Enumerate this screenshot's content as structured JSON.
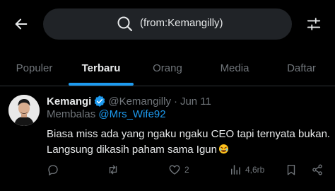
{
  "search": {
    "query": "(from:Kemangilly)"
  },
  "tabs": [
    {
      "label": "Populer"
    },
    {
      "label": "Terbaru"
    },
    {
      "label": "Orang"
    },
    {
      "label": "Media"
    },
    {
      "label": "Daftar"
    }
  ],
  "active_tab": "Terbaru",
  "tweet": {
    "display_name": "Kemangi",
    "handle": "@Kemangilly",
    "separator": "·",
    "date": "Jun 11",
    "reply_prefix": "Membalas",
    "reply_to": "@Mrs_Wife92",
    "text_line1": "Biasa miss ada yang ngaku ngaku CEO tapi ternyata bukan.",
    "text_line2": "Langsung dikasih paham sama Igun",
    "likes": "2",
    "views": "4,6rb"
  },
  "icons": {
    "back": "arrow-left-icon",
    "search": "search-icon",
    "filter": "sliders-icon",
    "verified": "verified-badge-icon",
    "emoji": "rofl-emoji-icon",
    "reply": "reply-icon",
    "retweet": "retweet-icon",
    "like": "heart-icon",
    "views": "views-chart-icon",
    "bookmark": "bookmark-icon",
    "share": "share-icon"
  },
  "colors": {
    "background": "#000000",
    "text": "#e7e9ea",
    "muted": "#71767b",
    "accent": "#1d9bf0",
    "search_bg": "#202327"
  }
}
